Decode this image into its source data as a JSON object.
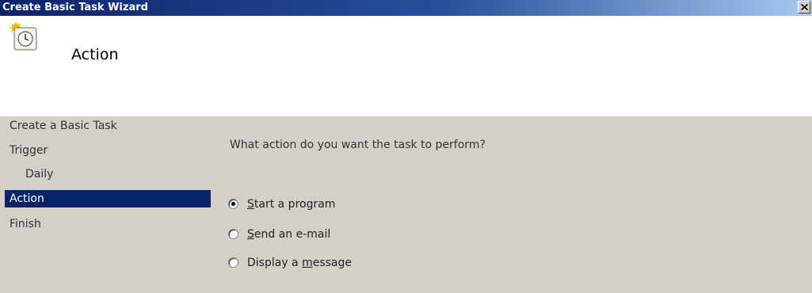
{
  "window": {
    "title": "Create Basic Task Wizard",
    "close_icon": "close-icon"
  },
  "header": {
    "icon": "task-clock-icon",
    "page_title": "Action"
  },
  "nav": {
    "items": [
      {
        "label": "Create a Basic Task",
        "level": 0,
        "selected": false
      },
      {
        "label": "Trigger",
        "level": 0,
        "selected": false
      },
      {
        "label": "Daily",
        "level": 1,
        "selected": false
      },
      {
        "label": "Action",
        "level": 0,
        "selected": true
      },
      {
        "label": "Finish",
        "level": 0,
        "selected": false
      }
    ]
  },
  "main": {
    "question": "What action do you want the task to perform?",
    "options": [
      {
        "label": "Start a program",
        "mnemonic_index": 0,
        "checked": true
      },
      {
        "label": "Send an e-mail",
        "mnemonic_index": 0,
        "checked": false
      },
      {
        "label": "Display a message",
        "mnemonic_index": 10,
        "checked": false
      }
    ]
  },
  "colors": {
    "titlebar_start": "#0a246a",
    "titlebar_end": "#a6caf0",
    "selection": "#0a246a",
    "face": "#d4d0c8"
  }
}
